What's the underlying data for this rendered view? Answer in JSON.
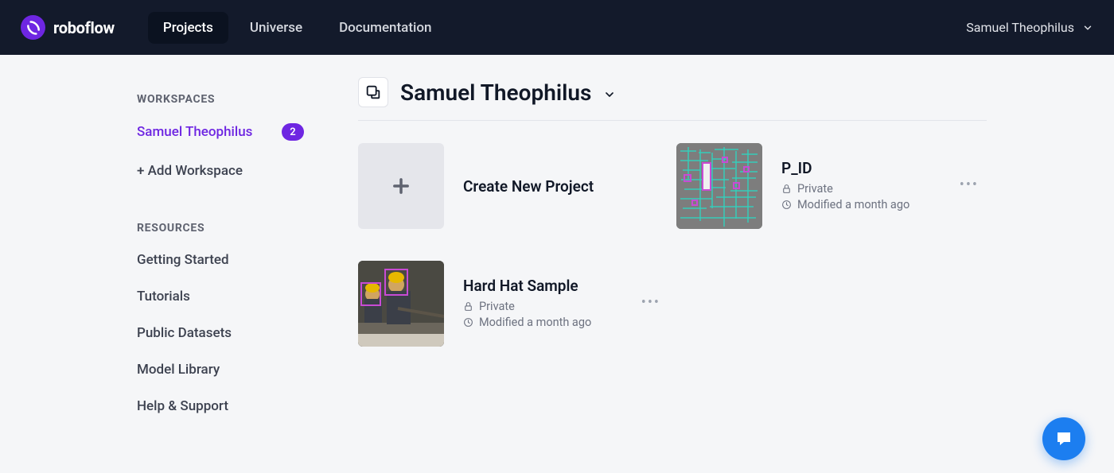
{
  "brand": "roboflow",
  "nav": {
    "projects": "Projects",
    "universe": "Universe",
    "documentation": "Documentation"
  },
  "user": {
    "name": "Samuel Theophilus"
  },
  "sidebar": {
    "workspaces_header": "WORKSPACES",
    "workspace": {
      "name": "Samuel Theophilus",
      "count": "2"
    },
    "add_workspace": "+ Add Workspace",
    "resources_header": "RESOURCES",
    "links": {
      "getting_started": "Getting Started",
      "tutorials": "Tutorials",
      "public_datasets": "Public Datasets",
      "model_library": "Model Library",
      "help_support": "Help & Support"
    }
  },
  "content": {
    "workspace_title": "Samuel Theophilus",
    "create": {
      "title": "Create New Project"
    },
    "projects": [
      {
        "title": "P_ID",
        "visibility": "Private",
        "modified": "Modified a month ago"
      },
      {
        "title": "Hard Hat Sample",
        "visibility": "Private",
        "modified": "Modified a month ago"
      }
    ]
  }
}
